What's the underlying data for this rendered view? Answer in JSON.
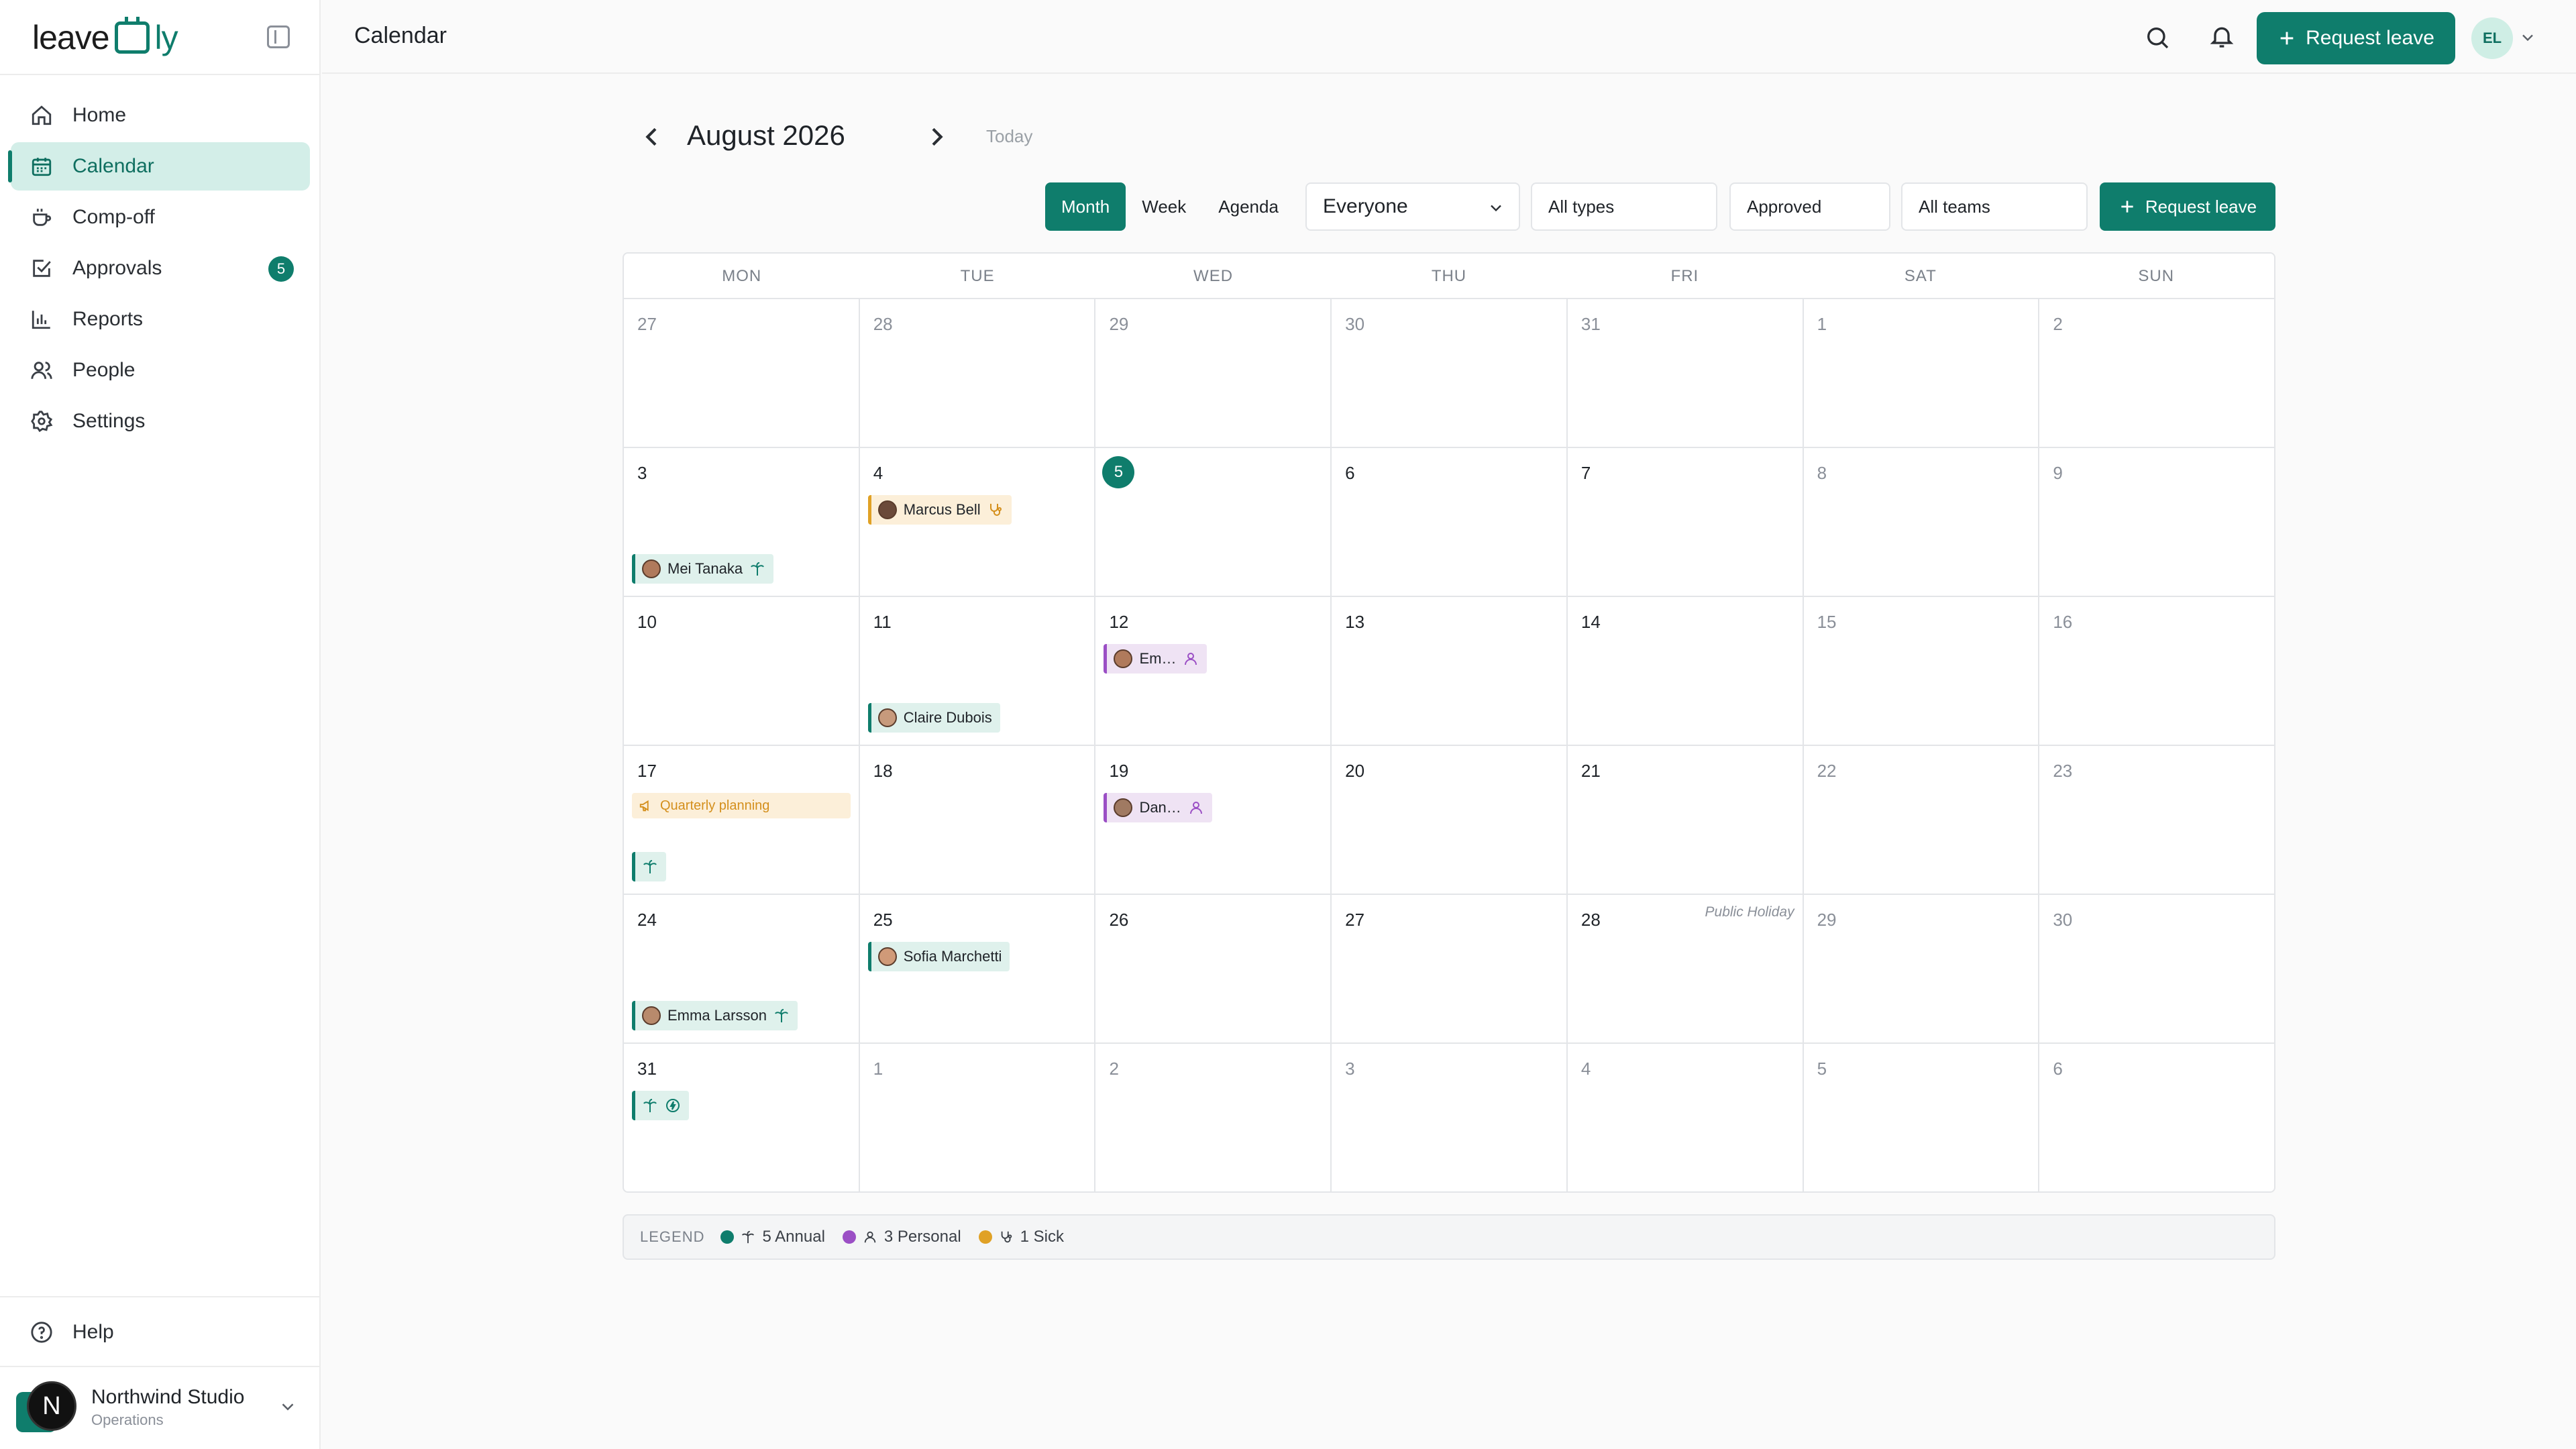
{
  "app": {
    "logo_main": "leave",
    "logo_tail": "ly"
  },
  "sidebar": {
    "items": [
      {
        "label": "Home",
        "icon": "home-icon"
      },
      {
        "label": "Calendar",
        "icon": "calendar-icon",
        "active": true
      },
      {
        "label": "Comp-off",
        "icon": "coffee-icon"
      },
      {
        "label": "Approvals",
        "icon": "check-square-icon",
        "badge": "5"
      },
      {
        "label": "Reports",
        "icon": "bar-chart-icon"
      },
      {
        "label": "People",
        "icon": "users-icon"
      },
      {
        "label": "Settings",
        "icon": "gear-icon"
      }
    ],
    "help_label": "Help",
    "workspace": {
      "initial": "N",
      "name": "Northwind Studio",
      "role": "Operations"
    }
  },
  "header": {
    "title": "Calendar",
    "request_label": "Request leave",
    "avatar_initials": "EL"
  },
  "calendar": {
    "month_label": "August 2026",
    "today_label": "Today",
    "views": [
      "Month",
      "Week",
      "Agenda"
    ],
    "active_view": "Month",
    "filters": {
      "people": "Everyone",
      "types": "All types",
      "status": "Approved",
      "teams": "All teams"
    },
    "request_label": "Request leave",
    "dow": [
      "MON",
      "TUE",
      "WED",
      "THU",
      "FRI",
      "SAT",
      "SUN"
    ],
    "weeks": [
      [
        "27",
        "28",
        "29",
        "30",
        "31",
        "1",
        "2"
      ],
      [
        "3",
        "4",
        "5",
        "6",
        "7",
        "8",
        "9"
      ],
      [
        "10",
        "11",
        "12",
        "13",
        "14",
        "15",
        "16"
      ],
      [
        "17",
        "18",
        "19",
        "20",
        "21",
        "22",
        "23"
      ],
      [
        "24",
        "25",
        "26",
        "27",
        "28",
        "29",
        "30"
      ],
      [
        "31",
        "1",
        "2",
        "3",
        "4",
        "5",
        "6"
      ]
    ],
    "holiday_label": "Public Holiday",
    "event_label": "Quarterly planning",
    "entries": {
      "mei": "Mei Tanaka",
      "marcus": "Marcus Bell",
      "em": "Em…",
      "claire": "Claire Dubois",
      "dan": "Dan…",
      "sofia": "Sofia Marchetti",
      "emma": "Emma Larsson"
    }
  },
  "legend": {
    "title": "LEGEND",
    "annual": "5 Annual",
    "personal": "3 Personal",
    "sick": "1 Sick"
  },
  "colors": {
    "accent": "#0f7d6c",
    "annual": "#0f7d6c",
    "personal": "#9b4fc5",
    "sick": "#e0a125"
  }
}
